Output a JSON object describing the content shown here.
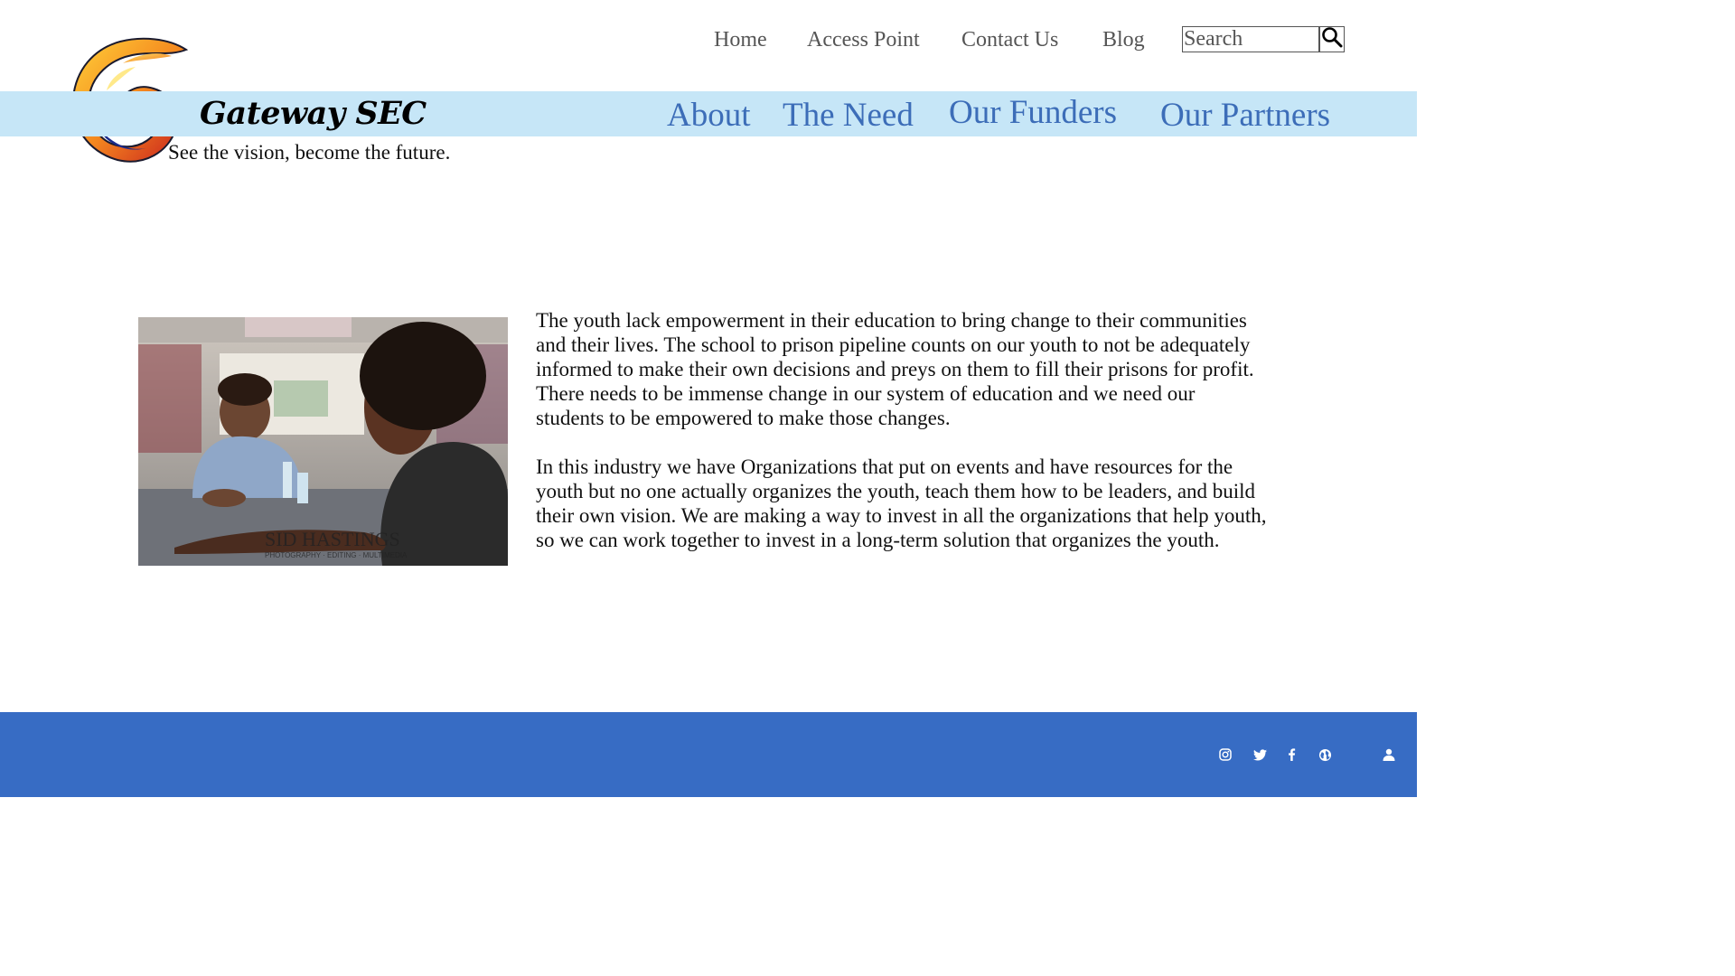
{
  "site": {
    "title": "Gateway SEC",
    "tagline": "See the vision, become the future."
  },
  "top_nav": [
    {
      "label": "Home"
    },
    {
      "label": "Access Point"
    },
    {
      "label": "Contact Us"
    },
    {
      "label": "Blog"
    }
  ],
  "search": {
    "placeholder": "Search",
    "icon": "magnifier-icon"
  },
  "main_nav": [
    {
      "label": "About"
    },
    {
      "label": "The Need"
    },
    {
      "label": "Our Funders"
    },
    {
      "label": "Our Partners"
    }
  ],
  "photo": {
    "watermark_name": "SID HASTINGS",
    "watermark_sub": "PHOTOGRAPHY · EDITING · MULTIMEDIA"
  },
  "content": {
    "paragraphs": [
      "The youth lack empowerment in their education to bring change to their communities and their lives. The school to prison pipeline counts on our youth to not be adequately informed to make their own decisions and preys on them to fill their prisons for profit. There needs to be immense change in our system of education and we need our students to be empowered to make those changes.",
      "In this industry we have Organizations that put on events and have resources for the youth but no one actually organizes the youth, teach them how to be leaders, and build their own vision. We are making a way to invest in all the organizations that help youth, so we can work together to invest in a long-term solution that organizes the youth."
    ]
  },
  "footer": {
    "icons": [
      "instagram-icon",
      "twitter-icon",
      "facebook-icon",
      "globe-icon",
      "user-icon"
    ]
  },
  "colors": {
    "band": "#c6e6f7",
    "main_nav": "#3c6db8",
    "footer": "#376cc4"
  }
}
